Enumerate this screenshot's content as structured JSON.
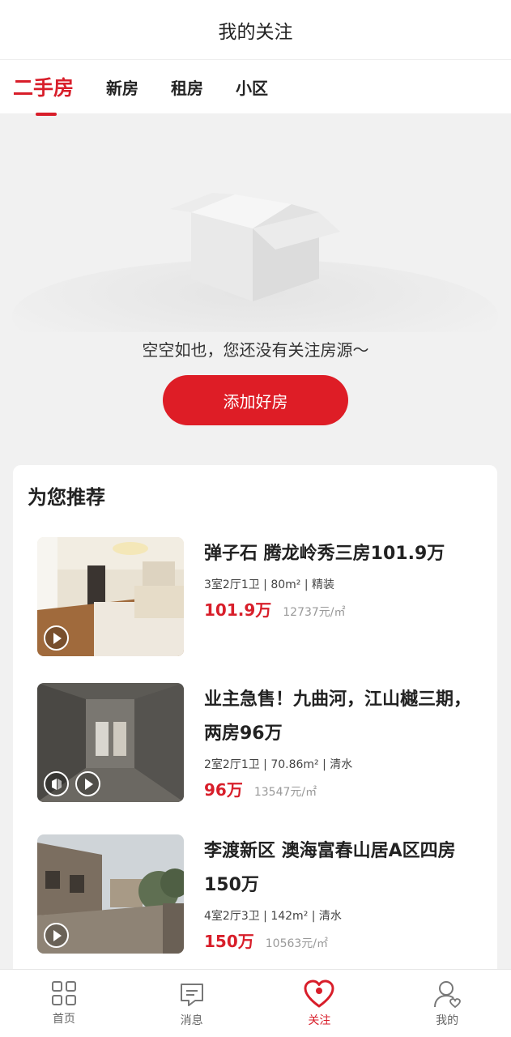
{
  "header": {
    "title": "我的关注"
  },
  "tabs": [
    {
      "label": "二手房",
      "active": true
    },
    {
      "label": "新房",
      "active": false
    },
    {
      "label": "租房",
      "active": false
    },
    {
      "label": "小区",
      "active": false
    }
  ],
  "empty": {
    "message": "空空如也，您还没有关注房源～",
    "button_label": "添加好房"
  },
  "recommend": {
    "title": "为您推荐",
    "items": [
      {
        "title": "弹子石 腾龙岭秀三房101.9万",
        "details": "3室2厅1卫 | 80m² | 精装",
        "price": "101.9万",
        "unit_price": "12737元/㎡",
        "has_vr": false
      },
      {
        "title": "业主急售！九曲河，江山樾三期，两房96万",
        "details": "2室2厅1卫 | 70.86m² | 清水",
        "price": "96万",
        "unit_price": "13547元/㎡",
        "has_vr": true
      },
      {
        "title": "李渡新区 澳海富春山居A区四房150万",
        "details": "4室2厅3卫 | 142m² | 清水",
        "price": "150万",
        "unit_price": "10563元/㎡",
        "has_vr": false
      }
    ]
  },
  "nav": [
    {
      "label": "首页",
      "icon": "grid-icon",
      "active": false
    },
    {
      "label": "消息",
      "icon": "chat-icon",
      "active": false
    },
    {
      "label": "关注",
      "icon": "heart-icon",
      "active": true
    },
    {
      "label": "我的",
      "icon": "user-icon",
      "active": false
    }
  ],
  "colors": {
    "accent": "#d81e2a",
    "button": "#de1d26"
  }
}
